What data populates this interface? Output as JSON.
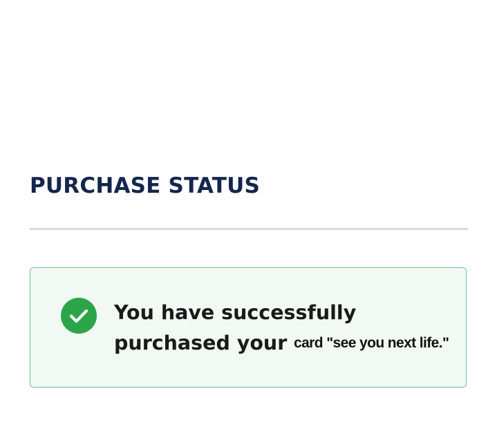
{
  "page": {
    "title": "PURCHASE STATUS"
  },
  "status": {
    "icon": "check-circle-icon",
    "line1": "You have successfully",
    "line2": "purchased your",
    "overlay_text": "card \"see you next life.\""
  },
  "colors": {
    "title": "#14264d",
    "divider": "#d9d9d9",
    "success_border": "#67c48a",
    "success_background": "#f2f9f4",
    "success_icon": "#2ba548",
    "message_text": "#1a1a1a"
  }
}
